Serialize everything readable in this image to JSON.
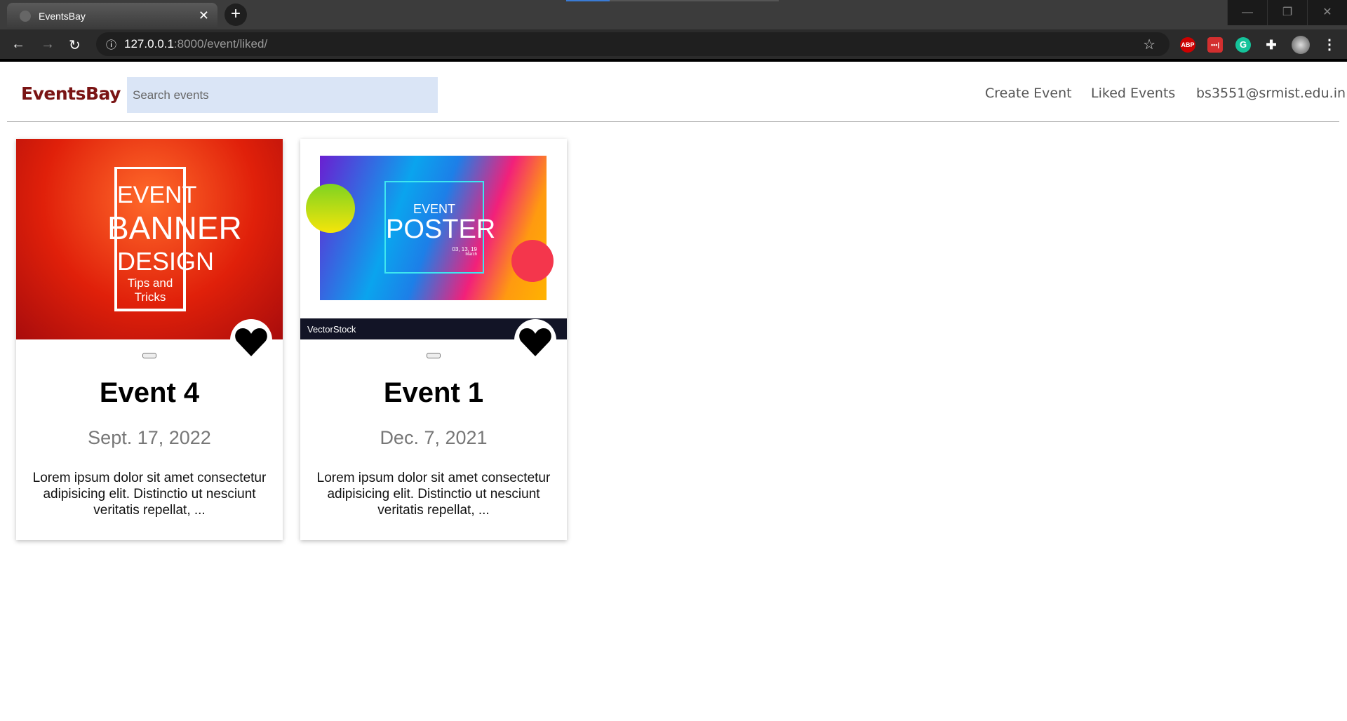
{
  "browser": {
    "tab_title": "EventsBay",
    "url_host": "127.0.0.1",
    "url_rest": ":8000/event/liked/",
    "extensions": [
      "ABP",
      "•••|",
      "G"
    ]
  },
  "header": {
    "logo": "EventsBay",
    "search_placeholder": "Search events",
    "links": [
      "Create Event",
      "Liked Events",
      "bs3551@srmist.edu.in"
    ]
  },
  "events": [
    {
      "title": "Event 4",
      "date": "Sept. 17, 2022",
      "description": "Lorem ipsum dolor sit amet consectetur adipisicing elit. Distinctio ut nesciunt veritatis repellat, ...",
      "image_text": [
        "EVENT",
        "BANNER",
        "DESIGN",
        "Tips and Tricks"
      ],
      "liked": true
    },
    {
      "title": "Event 1",
      "date": "Dec. 7, 2021",
      "description": "Lorem ipsum dolor sit amet consectetur adipisicing elit. Distinctio ut nesciunt veritatis repellat, ...",
      "image_text": [
        "EVENT",
        "POSTER",
        "03, 13, 19",
        "March",
        "VectorStock"
      ],
      "liked": true
    }
  ]
}
